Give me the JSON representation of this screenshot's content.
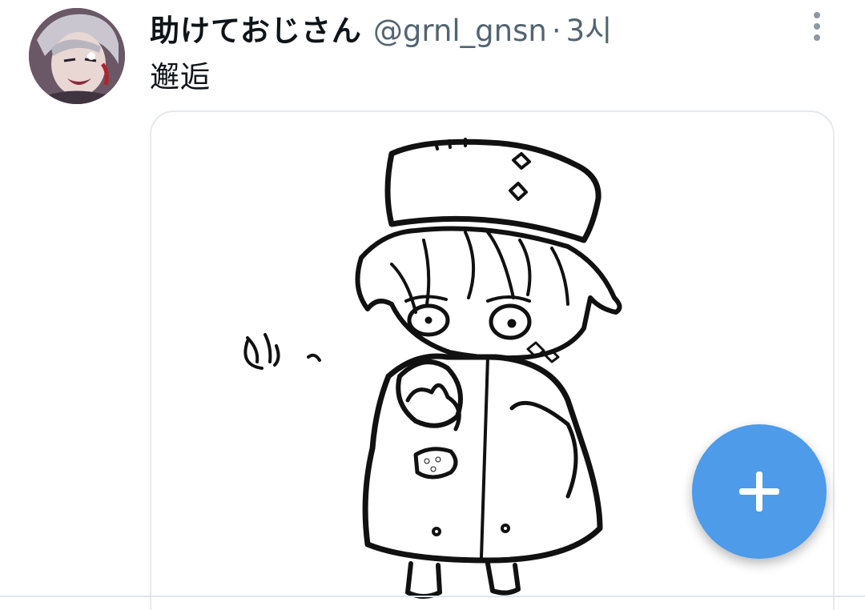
{
  "tweet": {
    "avatar_icon": "user-avatar",
    "display_name": "助けておじさん",
    "handle": "@grnl_gnsn",
    "separator": "·",
    "time": "3시",
    "text": "邂逅",
    "more_icon": "more-vertical-icon",
    "media": {
      "type": "drawing",
      "caption_in_image": "じっ"
    }
  },
  "fab": {
    "icon": "plus-icon",
    "color": "#4d9be9"
  },
  "colors": {
    "primary_text": "#0f1419",
    "secondary_text": "#536471",
    "accent": "#4d9be9",
    "border": "#e6e9ec"
  }
}
